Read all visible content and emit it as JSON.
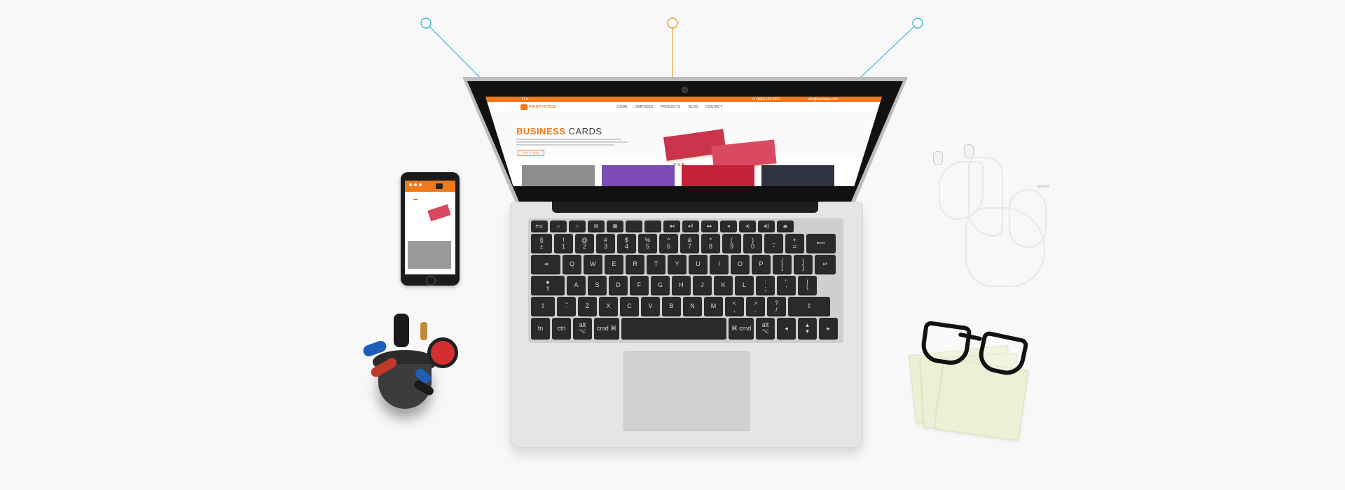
{
  "colors": {
    "accent": "#f07a1a",
    "callout_left": "#3ab5d6",
    "callout_center": "#e09a3a",
    "callout_right": "#3ab5d6"
  },
  "website": {
    "topbar": {
      "left": "f  t  in",
      "phone": "+1 (800) 123 4567",
      "email": "info@example.com"
    },
    "logo_text": "PRINTVOTICE",
    "nav": [
      "HOME",
      "SERVICES",
      "PRODUCTS",
      "BLOG",
      "CONTACT"
    ],
    "hero": {
      "title_accent": "BUSINESS",
      "title_rest": " CARDS",
      "button": "GET IT NOW"
    }
  },
  "keyboard": {
    "row1": [
      "esc",
      "☼",
      "☼",
      "▤",
      "▦",
      "",
      "",
      "◂◂",
      "▸ǁ",
      "▸▸",
      "◂",
      "◂)",
      "◂))",
      "⏏"
    ],
    "row2": [
      "§\n±",
      "!\n1",
      "@\n2",
      "#\n3",
      "$\n4",
      "%\n5",
      "^\n6",
      "&\n7",
      "*\n8",
      "(\n9",
      ")\n0",
      "_\n-",
      "+\n=",
      "⟵"
    ],
    "row3": [
      "⇥",
      "Q",
      "W",
      "E",
      "R",
      "T",
      "Y",
      "U",
      "I",
      "O",
      "P",
      "{\n[",
      "}\n]",
      "↵"
    ],
    "row4": [
      "●\n⇪",
      "A",
      "S",
      "D",
      "F",
      "G",
      "H",
      "J",
      "K",
      "L",
      ":\n;",
      "\"\n'",
      "|\n\\"
    ],
    "row5": [
      "⇧",
      "~\n`",
      "Z",
      "X",
      "C",
      "V",
      "B",
      "N",
      "M",
      "<\n,",
      ">\n.",
      "?\n/",
      "⇧"
    ],
    "row6": [
      "fn",
      "ctrl",
      "alt\n⌥",
      "cmd ⌘",
      "",
      "⌘ cmd",
      "alt\n⌥",
      "◂",
      "▴\n▾",
      "▸"
    ]
  },
  "icons": [
    "callout-marker-icon",
    "camera-icon",
    "home-button-icon",
    "earphones-icon",
    "glasses-icon",
    "pen-cup-icon"
  ]
}
